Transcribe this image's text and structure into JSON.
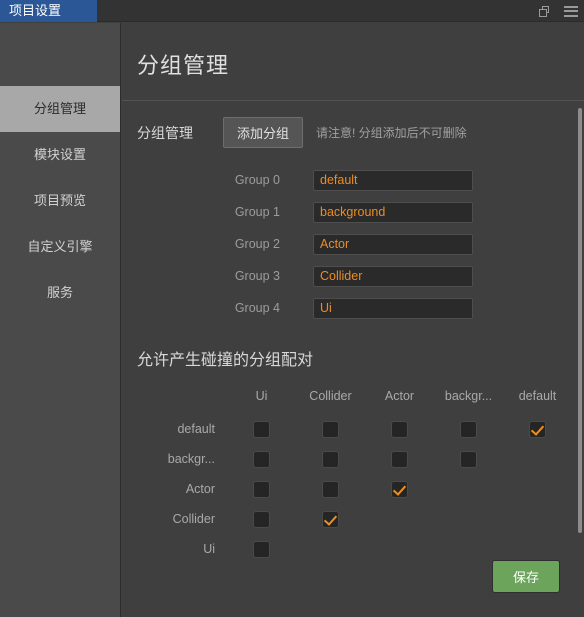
{
  "titlebar": {
    "tab_label": "项目设置",
    "restore_icon": "restore-window-icon",
    "menu_icon": "hamburger-menu-icon"
  },
  "sidebar": {
    "items": [
      {
        "label": "分组管理",
        "active": true
      },
      {
        "label": "模块设置",
        "active": false
      },
      {
        "label": "项目预览",
        "active": false
      },
      {
        "label": "自定义引擎",
        "active": false
      },
      {
        "label": "服务",
        "active": false
      }
    ]
  },
  "main": {
    "page_title": "分组管理",
    "group_section": {
      "label": "分组管理",
      "add_button": "添加分组",
      "note": "请注意! 分组添加后不可删除",
      "rows": [
        {
          "label": "Group 0",
          "value": "default"
        },
        {
          "label": "Group 1",
          "value": "background"
        },
        {
          "label": "Group 2",
          "value": "Actor"
        },
        {
          "label": "Group 3",
          "value": "Collider"
        },
        {
          "label": "Group 4",
          "value": "Ui"
        }
      ]
    },
    "matrix": {
      "title": "允许产生碰撞的分组配对",
      "columns": [
        "Ui",
        "Collider",
        "Actor",
        "backgr...",
        "default"
      ],
      "rows": [
        {
          "label": "default",
          "cells": [
            false,
            false,
            false,
            false,
            true
          ]
        },
        {
          "label": "backgr...",
          "cells": [
            false,
            false,
            false,
            false
          ]
        },
        {
          "label": "Actor",
          "cells": [
            false,
            false,
            true
          ]
        },
        {
          "label": "Collider",
          "cells": [
            false,
            true
          ]
        },
        {
          "label": "Ui",
          "cells": [
            false
          ]
        }
      ]
    },
    "save_button": "保存"
  },
  "colors": {
    "tab_accent": "#2b5797",
    "input_text": "#eb8c24",
    "checkbox_check": "#f0901f",
    "save_button_bg": "#6ca45c",
    "sidebar_active_bg": "#a8a8a8"
  }
}
